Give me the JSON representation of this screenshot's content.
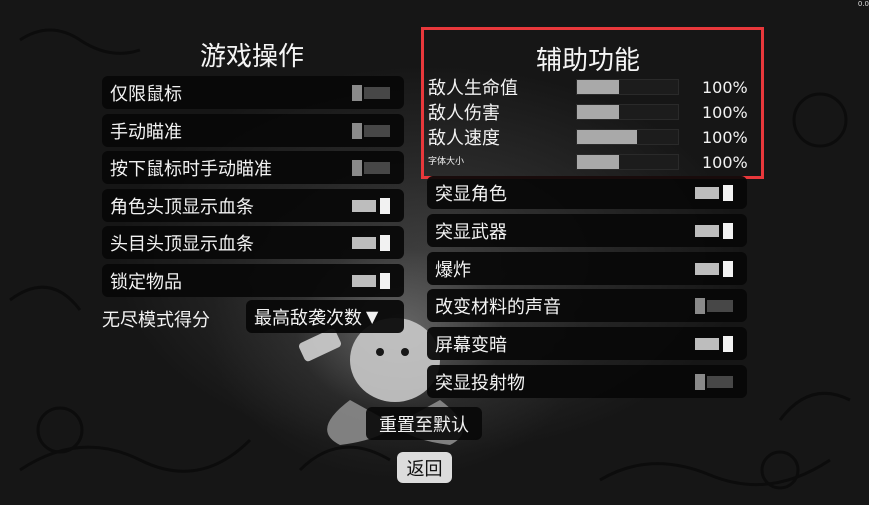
{
  "gameplay": {
    "title": "游戏操作",
    "toggles": [
      {
        "label": "仅限鼠标",
        "on": false
      },
      {
        "label": "手动瞄准",
        "on": false
      },
      {
        "label": "按下鼠标时手动瞄准",
        "on": false
      },
      {
        "label": "角色头顶显示血条",
        "on": true
      },
      {
        "label": "头目头顶显示血条",
        "on": true
      },
      {
        "label": "锁定物品",
        "on": true
      }
    ],
    "endless_label": "无尽模式得分",
    "endless_value": "最高敌袭次数"
  },
  "accessibility": {
    "title": "辅助功能",
    "sliders": [
      {
        "label": "敌人生命值",
        "value_text": "100%",
        "fill": 0.42
      },
      {
        "label": "敌人伤害",
        "value_text": "100%",
        "fill": 0.42
      },
      {
        "label": "敌人速度",
        "value_text": "100%",
        "fill": 0.59
      },
      {
        "label": "字体大小",
        "value_text": "100%",
        "fill": 0.42
      }
    ],
    "toggles": [
      {
        "label": "突显角色",
        "on": true
      },
      {
        "label": "突显武器",
        "on": true
      },
      {
        "label": "爆炸",
        "on": true
      },
      {
        "label": "改变材料的声音",
        "on": false
      },
      {
        "label": "屏幕变暗",
        "on": true
      },
      {
        "label": "突显投射物",
        "on": false
      }
    ]
  },
  "buttons": {
    "reset": "重置至默认",
    "back": "返回"
  },
  "corner_text": "0.0",
  "colors": {
    "highlight_border": "#e8383b",
    "toggle_on": "#f2f2f2",
    "toggle_off": "#8a8a8a",
    "slider_fill": "#a9a9a9"
  }
}
